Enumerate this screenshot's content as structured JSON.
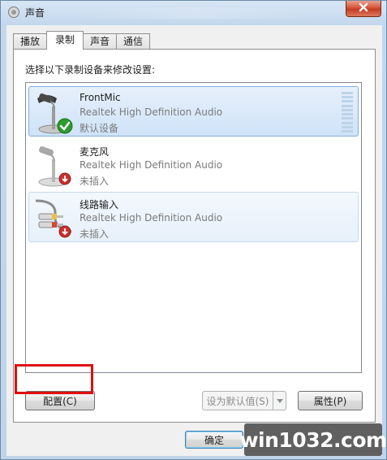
{
  "window": {
    "title": "声音"
  },
  "tabs": [
    {
      "label": "播放",
      "active": false
    },
    {
      "label": "录制",
      "active": true
    },
    {
      "label": "声音",
      "active": false
    },
    {
      "label": "通信",
      "active": false
    }
  ],
  "panel": {
    "instruction": "选择以下录制设备来修改设置:"
  },
  "devices": [
    {
      "name": "FrontMic",
      "driver": "Realtek High Definition Audio",
      "status": "默认设备",
      "icon": "microphone-icon",
      "badge": "default-check-icon"
    },
    {
      "name": "麦克风",
      "driver": "Realtek High Definition Audio",
      "status": "未插入",
      "icon": "microphone-icon",
      "badge": "unplugged-icon"
    },
    {
      "name": "线路输入",
      "driver": "Realtek High Definition Audio",
      "status": "未插入",
      "icon": "line-in-jack-icon",
      "badge": "unplugged-icon"
    }
  ],
  "buttons": {
    "configure": "配置(C)",
    "set_default": "设为默认值(S)",
    "properties": "属性(P)",
    "ok": "确定"
  },
  "watermark": "win1032.com",
  "colors": {
    "selection": "#cfe3f8",
    "highlight_box": "#e00f0f",
    "default_badge": "#2e9b2e",
    "unplugged_badge": "#c9302c"
  }
}
